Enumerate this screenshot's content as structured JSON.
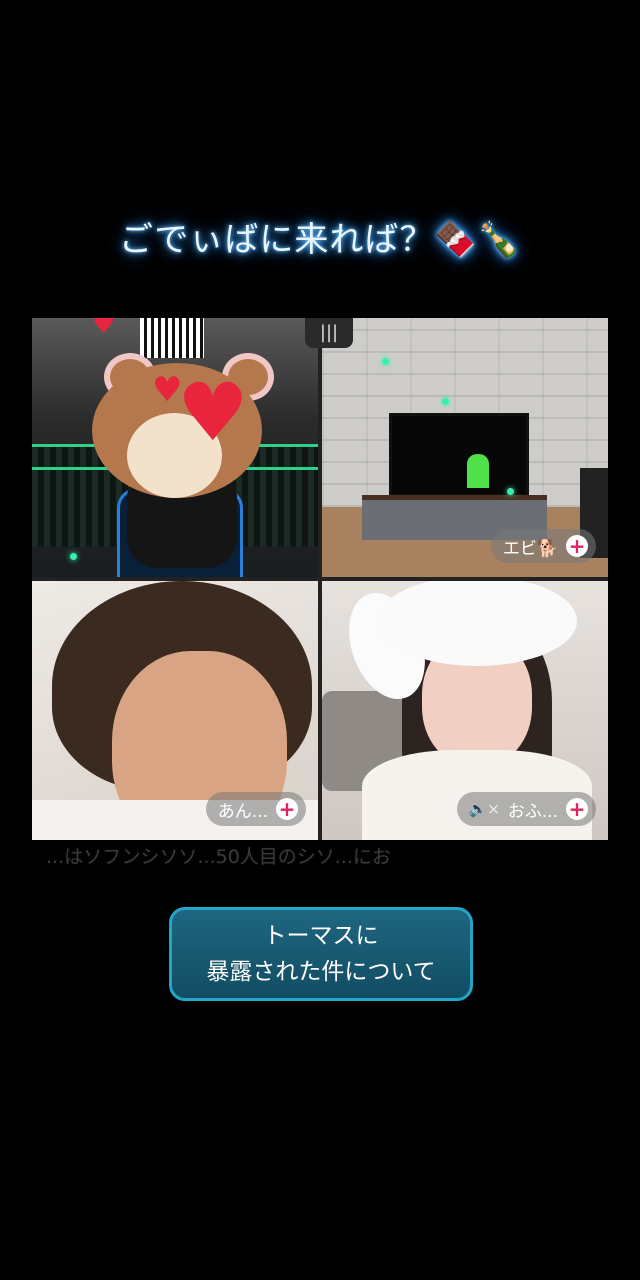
{
  "title": "ごでぃばに来れば？🍫🍾",
  "tiles": [
    {
      "name": "",
      "muted": false
    },
    {
      "name": "エビ🐕",
      "muted": false
    },
    {
      "name": "あん...",
      "muted": false
    },
    {
      "name": "おふ...",
      "muted": true
    }
  ],
  "follow_label": "+",
  "mute_icon": "🔈×",
  "poll_icon": "|||",
  "scroll_text": {
    "main": "...はソフンシソソ...50人目のシソ...にお",
    "tail": ""
  },
  "caption": {
    "line1": "トーマスに",
    "line2": "暴露された件について"
  },
  "colors": {
    "accent": "#22a6c8",
    "heart": "#e8253c",
    "sparkle": "#36f0b0",
    "title_glow": "#3aa0ff"
  },
  "icons": {
    "heart": "heart-icon",
    "plus": "plus-icon",
    "mute": "speaker-muted-icon",
    "poll": "signal-bars-icon"
  }
}
